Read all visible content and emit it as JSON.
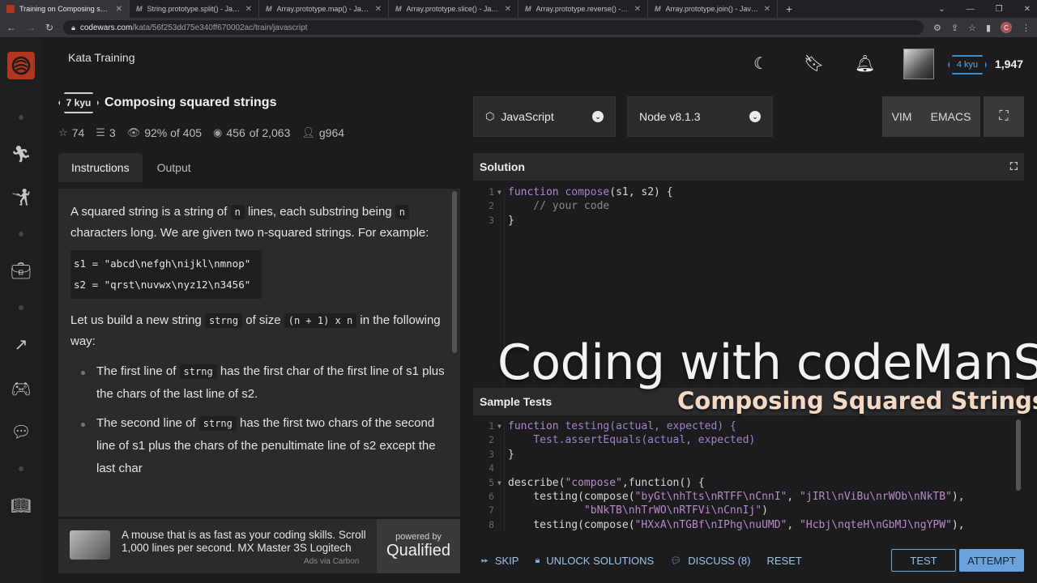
{
  "browser": {
    "tabs": [
      {
        "title": "Training on Composing squared",
        "active": true
      },
      {
        "title": "String.prototype.split() - JavaScri"
      },
      {
        "title": "Array.prototype.map() - JavaScri"
      },
      {
        "title": "Array.prototype.slice() - JavaScri"
      },
      {
        "title": "Array.prototype.reverse() - JavaS"
      },
      {
        "title": "Array.prototype.join() - JavaScri"
      }
    ],
    "url_domain": "codewars.com",
    "url_path": "/kata/56f253dd75e340ff670002ac/train/javascript",
    "profile_initial": "C"
  },
  "header": {
    "section": "Kata Training",
    "rank": "4 kyu",
    "honor": "1,947"
  },
  "kata": {
    "kyu": "7 kyu",
    "title": "Composing squared strings",
    "stars": "74",
    "collections": "3",
    "satisfaction": "92% of 405",
    "completed": "456",
    "completed_of": "of 2,063",
    "author": "g964"
  },
  "tabs": {
    "instructions": "Instructions",
    "output": "Output"
  },
  "description": {
    "p1_a": "A squared string is a string of ",
    "p1_n1": "n",
    "p1_b": " lines, each substring being ",
    "p1_n2": "n",
    "p1_c": " characters long. We are given two n-squared strings. For example:",
    "code1": "s1 = \"abcd\\nefgh\\nijkl\\nmnop\"",
    "code2": "s2 = \"qrst\\nuvwx\\nyz12\\n3456\"",
    "p2_a": "Let us build a new string ",
    "p2_code": "strng",
    "p2_b": " of size ",
    "p2_size": "(n + 1) x n",
    "p2_c": " in the following way:",
    "li1_a": "The first line of ",
    "li1_code": "strng",
    "li1_b": " has the first char of the first line of s1 plus the chars of the last line of s2.",
    "li2_a": "The second line of ",
    "li2_code": "strng",
    "li2_b": " has the first two chars of the second line of s1 plus the chars of the penultimate line of s2 except the last char"
  },
  "ad": {
    "text": "A mouse that is as fast as your coding skills. Scroll 1,000 lines per second. MX Master 3S Logitech",
    "via": "Ads via Carbon",
    "powered_by": "powered by",
    "brand": "Qualified"
  },
  "editor_opts": {
    "language": "JavaScript",
    "version": "Node v8.1.3",
    "vim": "VIM",
    "emacs": "EMACS"
  },
  "solution": {
    "title": "Solution",
    "lines": [
      {
        "n": "1",
        "fold": true
      },
      {
        "n": "2"
      },
      {
        "n": "3"
      }
    ],
    "l1_kw": "function",
    "l1_fn": " compose",
    "l1_rest": "(s1, s2) {",
    "l2": "    // your code",
    "l3": "}"
  },
  "sample_tests": {
    "title": "Sample Tests",
    "l1_kw": "function",
    "l1_fn": " testing",
    "l1_rest": "(actual, expected) {",
    "l2": "    Test.assertEquals(actual, expected)",
    "l3": "}",
    "l4": "",
    "l5_a": "describe(",
    "l5_str": "\"compose\"",
    "l5_b": ",function() {",
    "l6_a": "    testing(compose(",
    "l6_s1": "\"byGt\\nhTts\\nRTFF\\nCnnI\"",
    "l6_b": ", ",
    "l6_s2": "\"jIRl\\nViBu\\nrWOb\\nNkTB\"",
    "l6_c": "),",
    "l7_a": "            ",
    "l7_s": "\"bNkTB\\nhTrWO\\nRTFVi\\nCnnIj\"",
    "l7_b": ")",
    "l8_a": "    testing(compose(",
    "l8_s1": "\"HXxA\\nTGBf\\nIPhg\\nuUMD\"",
    "l8_b": ", ",
    "l8_s2": "\"Hcbj\\nqteH\\nGbMJ\\ngYPW\"",
    "l8_c": "),"
  },
  "overlay": {
    "title": "Coding with codeManS",
    "subtitle": "Composing Squared Strings"
  },
  "actions": {
    "skip": "SKIP",
    "unlock": "UNLOCK SOLUTIONS",
    "discuss": "DISCUSS (8)",
    "reset": "RESET",
    "test": "TEST",
    "attempt": "ATTEMPT"
  },
  "colors": {
    "brand": "#b1361e",
    "accent": "#6aa2dc",
    "rank_blue": "#3c8fd3"
  }
}
